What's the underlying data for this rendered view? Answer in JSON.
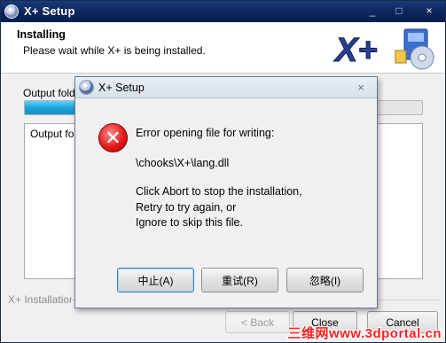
{
  "window": {
    "title": "X+ Setup",
    "controls": {
      "minimize": "_",
      "maximize": "□",
      "close": "×"
    }
  },
  "header": {
    "title": "Installing",
    "subtitle": "Please wait while X+ is being installed.",
    "logo_text": "X+"
  },
  "main": {
    "status_label": "Output folde",
    "progress_fraction": 0.33,
    "details_first_line": "Output fol"
  },
  "footer": {
    "branding": "X+ Installation",
    "buttons": {
      "back": "< Back",
      "close": "Close",
      "cancel": "Cancel"
    },
    "back_accel": "B",
    "close_accel": "l"
  },
  "watermark": "三维网www.3dportal.cn",
  "dialog": {
    "title": "X+ Setup",
    "close": "×",
    "message": {
      "line1": "Error opening file for writing:",
      "line2": "\\chooks\\X+\\lang.dll",
      "line3": "Click Abort to stop the installation,",
      "line4": "Retry to try again, or",
      "line5": "Ignore to skip this file."
    },
    "buttons": {
      "abort": "中止(A)",
      "retry": "重试(R)",
      "ignore": "忽略(I)"
    }
  },
  "colors": {
    "titlebar": "#0b2358",
    "progress": "#1ea3d9",
    "error": "#e21b1b",
    "watermark": "#ff2020"
  },
  "icons": {
    "app": "setup-disc-icon",
    "error": "error-x-icon"
  }
}
